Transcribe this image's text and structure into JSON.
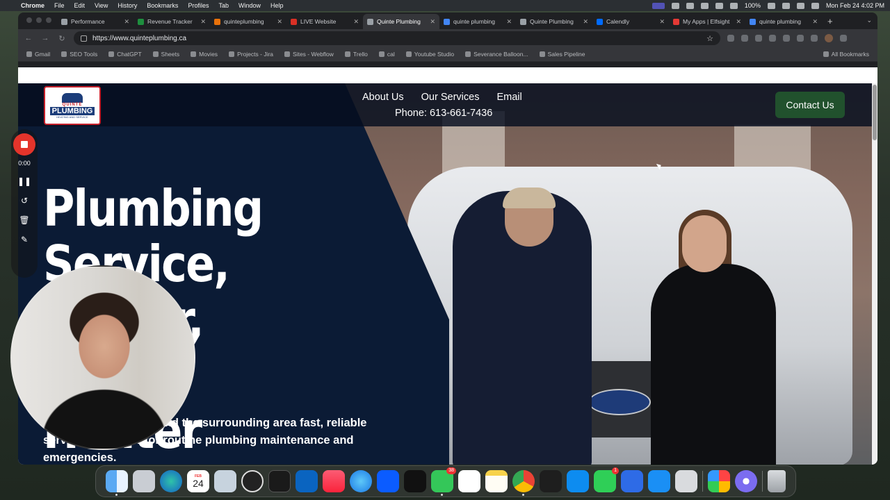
{
  "menubar": {
    "app_name": "Chrome",
    "menus": [
      "File",
      "Edit",
      "View",
      "History",
      "Bookmarks",
      "Profiles",
      "Tab",
      "Window",
      "Help"
    ],
    "battery": "100%",
    "datetime": "Mon Feb 24  4:02 PM"
  },
  "tabs": [
    {
      "label": "Performance",
      "favicon_color": "#9aa0a6"
    },
    {
      "label": "Revenue Tracker",
      "favicon_color": "#1e8e3e"
    },
    {
      "label": "quinteplumbing",
      "favicon_color": "#e8710a"
    },
    {
      "label": "LIVE Website",
      "favicon_color": "#d93025"
    },
    {
      "label": "Quinte Plumbing",
      "favicon_color": "#9aa0a6",
      "active": true
    },
    {
      "label": "quinte plumbing",
      "favicon_color": "#4285f4"
    },
    {
      "label": "Quinte Plumbing",
      "favicon_color": "#9aa0a6"
    },
    {
      "label": "Calendly",
      "favicon_color": "#006bff"
    },
    {
      "label": "My Apps | Elfsight",
      "favicon_color": "#e53935"
    },
    {
      "label": "quinte plumbing",
      "favicon_color": "#4285f4"
    }
  ],
  "address_bar": {
    "url": "https://www.quinteplumbing.ca"
  },
  "bookmarks": [
    "Gmail",
    "SEO Tools",
    "ChatGPT",
    "Sheets",
    "Movies",
    "Projects - Jira",
    "Sites - Webflow",
    "Trello",
    "cal",
    "Youtube Studio",
    "Severance Balloon...",
    "Sales Pipeline"
  ],
  "bookmarks_all": "All Bookmarks",
  "site": {
    "logo": {
      "top": "QUINTE",
      "main": "PLUMBING",
      "bottom": "HEATING AND SERVICE"
    },
    "nav": [
      "About Us",
      "Our Services",
      "Email"
    ],
    "phone": "Phone: 613-661-7436",
    "cta": "Contact Us",
    "hero_title": "Plumbing Service, Repair, Water Heater Replacement",
    "hero_subtitle": "Serving Quinte West and the surrounding area fast, reliable service and repair for routine plumbing maintenance and emergencies.",
    "colors": {
      "navy": "#0b1b35",
      "cta_green": "#21512d"
    }
  },
  "recorder": {
    "time": "0:00"
  },
  "dock": {
    "calendar": {
      "month": "FEB",
      "day": "24"
    },
    "messages_badge": "38",
    "facetime_badge": "1",
    "apps": [
      "finder",
      "launchpad",
      "edge",
      "calendar",
      "preview",
      "obs",
      "activity-monitor",
      "outlook",
      "music",
      "safari",
      "zoom",
      "apple-tv",
      "messages",
      "slack",
      "notes",
      "chrome",
      "figma",
      "kick",
      "facetime",
      "docs",
      "app-store",
      "mirror",
      "photos",
      "settings",
      "trash"
    ]
  }
}
